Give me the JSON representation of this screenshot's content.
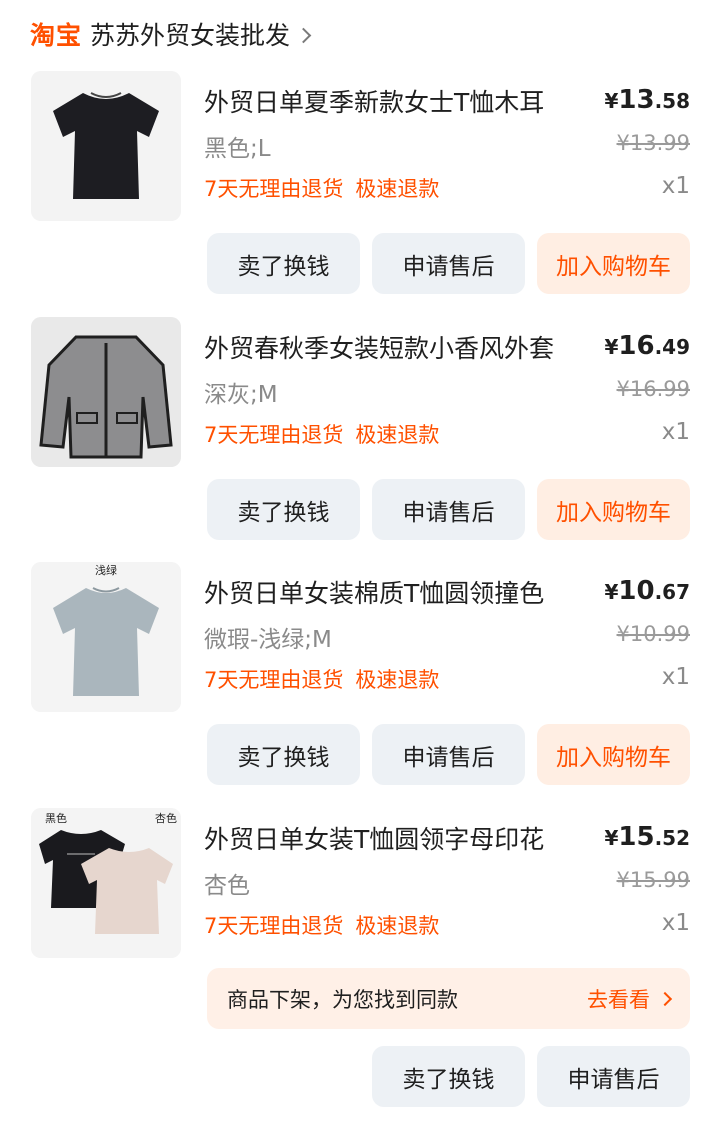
{
  "shop": {
    "logo": "淘宝",
    "name": "苏苏外贸女装批发",
    "chevron_icon": "chevron-right-icon"
  },
  "items": [
    {
      "title": "外贸日单夏季新款女士T恤木耳",
      "spec": "黑色;L",
      "price_currency": "¥",
      "price_int": "13",
      "price_dec": ".58",
      "original_price": "¥13.99",
      "quantity": "x1",
      "tags": [
        "7天无理由退货",
        "极速退款"
      ],
      "buttons": [
        "卖了换钱",
        "申请售后",
        "加入购物车"
      ]
    },
    {
      "title": "外贸春秋季女装短款小香风外套",
      "spec": "深灰;M",
      "price_currency": "¥",
      "price_int": "16",
      "price_dec": ".49",
      "original_price": "¥16.99",
      "quantity": "x1",
      "tags": [
        "7天无理由退货",
        "极速退款"
      ],
      "buttons": [
        "卖了换钱",
        "申请售后",
        "加入购物车"
      ]
    },
    {
      "title": "外贸日单女装棉质T恤圆领撞色",
      "spec": "微瑕-浅绿;M",
      "thumb_label": "浅绿",
      "price_currency": "¥",
      "price_int": "10",
      "price_dec": ".67",
      "original_price": "¥10.99",
      "quantity": "x1",
      "tags": [
        "7天无理由退货",
        "极速退款"
      ],
      "buttons": [
        "卖了换钱",
        "申请售后",
        "加入购物车"
      ]
    },
    {
      "title": "外贸日单女装T恤圆领字母印花",
      "spec": "杏色",
      "thumb_label_left": "黑色",
      "thumb_label_right": "杏色",
      "price_currency": "¥",
      "price_int": "15",
      "price_dec": ".52",
      "original_price": "¥15.99",
      "quantity": "x1",
      "tags": [
        "7天无理由退货",
        "极速退款"
      ]
    }
  ],
  "offline_notice": {
    "text": "商品下架，为您找到同款",
    "link": "去看看"
  },
  "bottom_buttons": [
    "卖了换钱",
    "申请售后"
  ],
  "colors": {
    "accent": "#ff5000",
    "button_bg": "#edf1f5",
    "accent_button_bg": "#ffeee3"
  }
}
